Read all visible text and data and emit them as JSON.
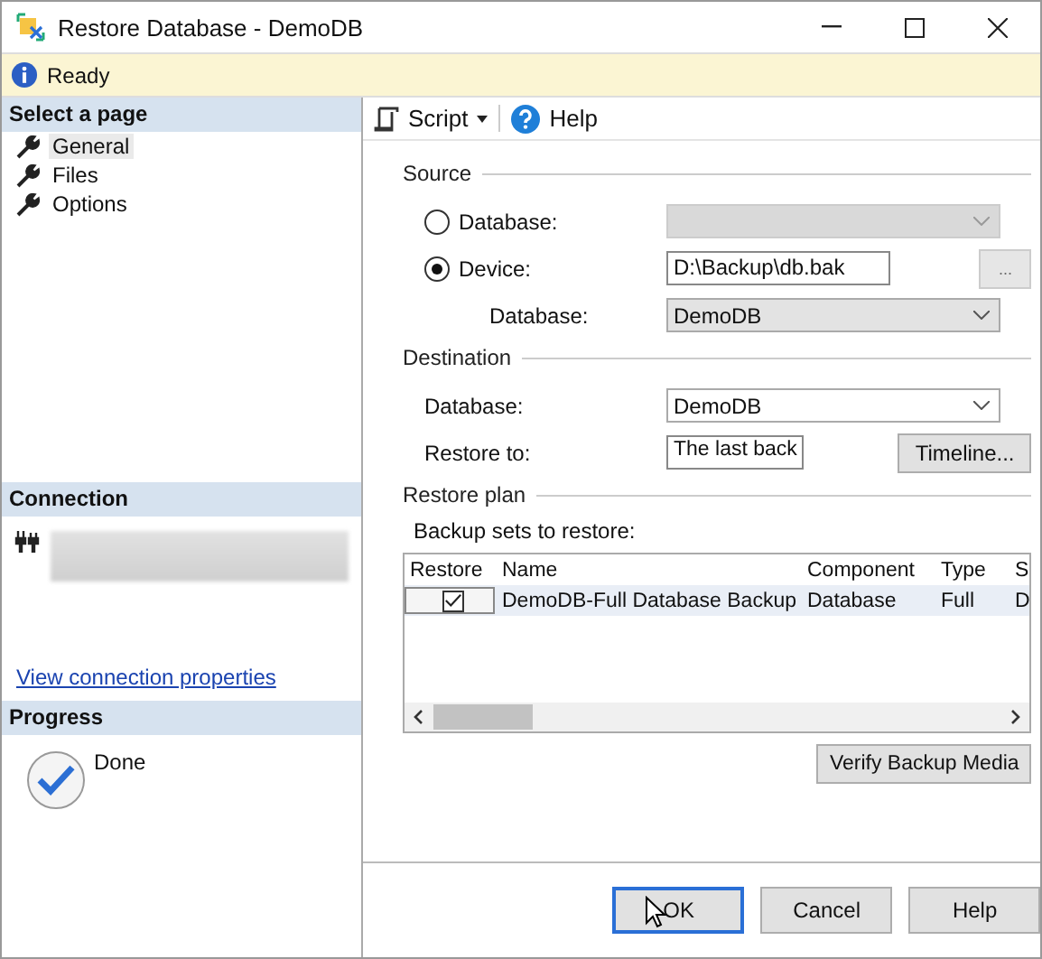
{
  "window": {
    "title": "Restore Database - DemoDB"
  },
  "status": "Ready",
  "sidebar": {
    "heading": "Select a page",
    "pages": [
      {
        "label": "General",
        "selected": true
      },
      {
        "label": "Files",
        "selected": false
      },
      {
        "label": "Options",
        "selected": false
      }
    ],
    "connection": {
      "heading": "Connection",
      "link": "View connection properties"
    },
    "progress": {
      "heading": "Progress",
      "status": "Done"
    }
  },
  "toolbar": {
    "script": "Script",
    "help": "Help"
  },
  "source": {
    "heading": "Source",
    "options": [
      {
        "kind": "combo",
        "label": "Database:",
        "selected": false,
        "disabled": true
      },
      {
        "kind": "path",
        "label": "Device:",
        "selected": true,
        "value": "D:\\Backup\\db.bak",
        "browse": "..."
      }
    ],
    "database_label": "Database:",
    "database": "DemoDB"
  },
  "destination": {
    "heading": "Destination",
    "database_label": "Database:",
    "database": "DemoDB",
    "restore_to_label": "Restore to:",
    "restore_to": "The last back",
    "timeline": "Timeline..."
  },
  "restore_plan": {
    "heading": "Restore plan",
    "label": "Backup sets to restore:",
    "columns": [
      "Restore",
      "Name",
      "Component",
      "Type",
      "S"
    ],
    "rows": [
      {
        "checked": true,
        "name": "DemoDB-Full Database Backup",
        "component": "Database",
        "type": "Full",
        "column_5": "D"
      }
    ],
    "verify": "Verify Backup Media"
  },
  "buttons": [
    "OK",
    "Cancel",
    "Help"
  ]
}
